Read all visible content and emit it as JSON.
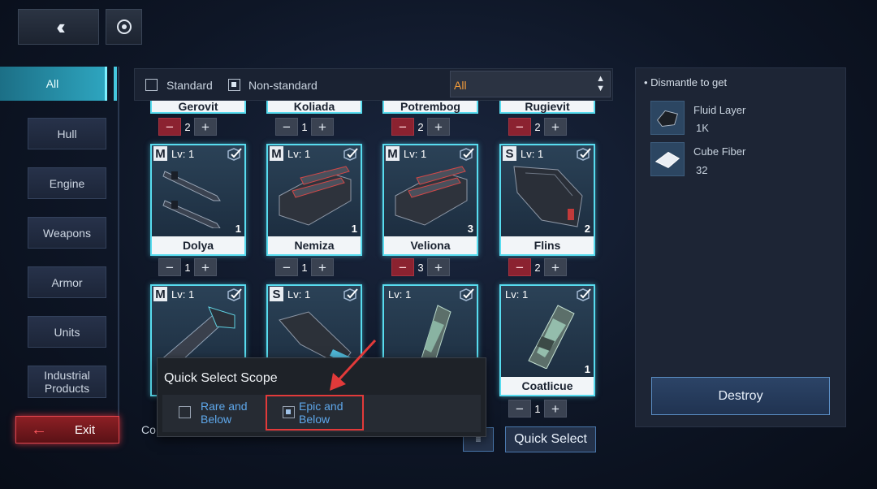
{
  "top": {
    "back_icon": "double-chevron-left-icon",
    "refresh_icon": "refresh-icon"
  },
  "sidebar": {
    "items": [
      {
        "label": "All",
        "active": true
      },
      {
        "label": "Hull"
      },
      {
        "label": "Engine"
      },
      {
        "label": "Weapons"
      },
      {
        "label": "Armor"
      },
      {
        "label": "Units"
      },
      {
        "label": "Industrial Products"
      }
    ],
    "exit_label": "Exit"
  },
  "filter": {
    "standard_label": "Standard",
    "standard_checked": false,
    "nonstandard_label": "Non-standard",
    "nonstandard_checked": true,
    "select_value": "All"
  },
  "top_row": [
    {
      "name": "Gerovit",
      "count": "2",
      "minus_active": true
    },
    {
      "name": "Koliada",
      "count": "1",
      "minus_active": false
    },
    {
      "name": "Potrembog",
      "count": "2",
      "minus_active": true
    },
    {
      "name": "Rugievit",
      "count": "2",
      "minus_active": true
    }
  ],
  "cards": [
    {
      "grade": "M",
      "level": "Lv: 1",
      "name": "Dolya",
      "qty": "1",
      "selected": "1",
      "minus_active": false
    },
    {
      "grade": "M",
      "level": "Lv: 1",
      "name": "Nemiza",
      "qty": "1",
      "selected": "1",
      "minus_active": false
    },
    {
      "grade": "M",
      "level": "Lv: 1",
      "name": "Veliona",
      "qty": "3",
      "selected": "3",
      "minus_active": true
    },
    {
      "grade": "S",
      "level": "Lv: 1",
      "name": "Flins",
      "qty": "2",
      "selected": "2",
      "minus_active": true
    },
    {
      "grade": "M",
      "level": "Lv: 1",
      "name": "",
      "qty": ""
    },
    {
      "grade": "S",
      "level": "Lv: 1",
      "name": "",
      "qty": ""
    },
    {
      "grade": "",
      "level": "Lv: 1",
      "name": "",
      "qty": ""
    },
    {
      "grade": "",
      "level": "Lv: 1",
      "name": "Coatlicue",
      "qty": "1",
      "selected": "1",
      "minus_active": false
    }
  ],
  "right_panel": {
    "title": "Dismantle to get",
    "items": [
      {
        "name": "Fluid Layer",
        "qty": "1K"
      },
      {
        "name": "Cube Fiber",
        "qty": "32"
      }
    ],
    "destroy_label": "Destroy"
  },
  "bottom": {
    "label_partial": "Co",
    "quick_select_label": "Quick Select"
  },
  "popup": {
    "title": "Quick Select Scope",
    "options": [
      {
        "label": "Rare and Below",
        "checked": false
      },
      {
        "label": "Epic and Below",
        "checked": true
      }
    ]
  },
  "colors": {
    "accent_cyan": "#58dcef",
    "exit_red": "#e0464e",
    "select_orange": "#f09a3a",
    "popup_link_blue": "#5ea7ea",
    "highlight_red": "#e23a3a"
  }
}
